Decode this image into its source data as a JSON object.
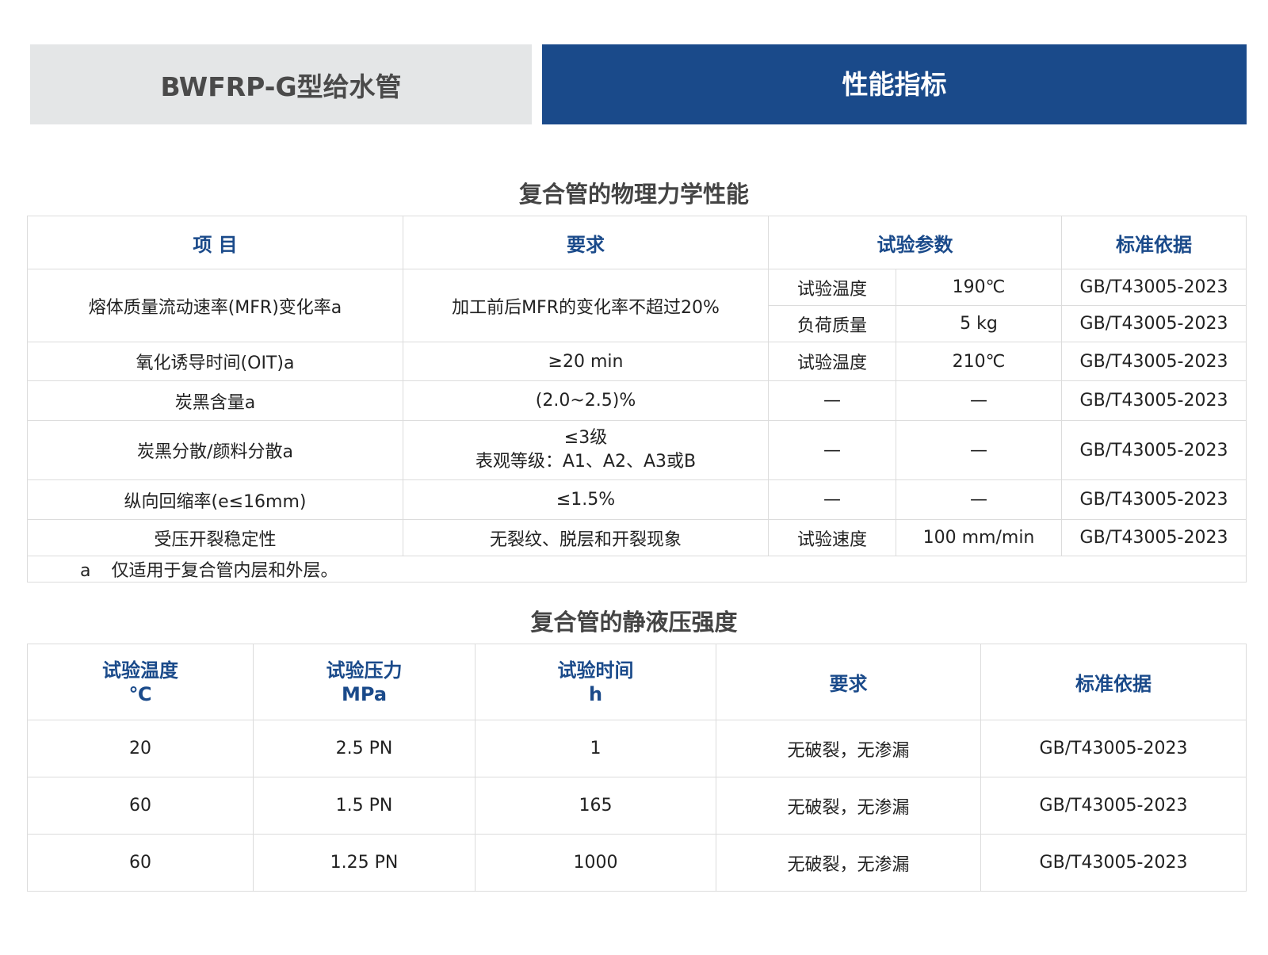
{
  "header": {
    "product": "BWFRP-G型给水管",
    "section": "性能指标"
  },
  "table1": {
    "title": "复合管的物理力学性能",
    "headers": [
      "项 目",
      "要求",
      "试验参数",
      "标准依据"
    ],
    "rows": {
      "mfr": {
        "item": "熔体质量流动速率(MFR)变化率a",
        "req": "加工前后MFR的变化率不超过20%",
        "p1_name": "试验温度",
        "p1_val": "190℃",
        "p1_std": "GB/T43005-2023",
        "p2_name": "负荷质量",
        "p2_val": "5 kg",
        "p2_std": "GB/T43005-2023"
      },
      "oit": {
        "item": "氧化诱导时间(OIT)a",
        "req": "≥20 min",
        "p_name": "试验温度",
        "p_val": "210℃",
        "std": "GB/T43005-2023"
      },
      "cb": {
        "item": "炭黑含量a",
        "req": "(2.0~2.5)%",
        "p_name": "—",
        "p_val": "—",
        "std": "GB/T43005-2023"
      },
      "disp": {
        "item": "炭黑分散/颜料分散a",
        "req_line1": "≤3级",
        "req_line2": "表观等级：A1、A2、A3或B",
        "p_name": "—",
        "p_val": "—",
        "std": "GB/T43005-2023"
      },
      "shrink": {
        "item": "纵向回缩率(e≤16mm)",
        "req": "≤1.5%",
        "p_name": "—",
        "p_val": "—",
        "std": "GB/T43005-2023"
      },
      "crack": {
        "item": "受压开裂稳定性",
        "req": "无裂纹、脱层和开裂现象",
        "p_name": "试验速度",
        "p_val": "100 mm/min",
        "std": "GB/T43005-2023"
      }
    },
    "note": {
      "letter": "a",
      "text": "仅适用于复合管内层和外层。"
    }
  },
  "table2": {
    "title": "复合管的静液压强度",
    "headers": [
      {
        "label": "试验温度",
        "unit": "℃"
      },
      {
        "label": "试验压力",
        "unit": "MPa"
      },
      {
        "label": "试验时间",
        "unit": "h"
      },
      {
        "label": "要求",
        "unit": ""
      },
      {
        "label": "标准依据",
        "unit": ""
      }
    ],
    "rows": [
      {
        "temp": "20",
        "pressure": "2.5 PN",
        "time": "1",
        "req": "无破裂，无渗漏",
        "std": "GB/T43005-2023"
      },
      {
        "temp": "60",
        "pressure": "1.5 PN",
        "time": "165",
        "req": "无破裂，无渗漏",
        "std": "GB/T43005-2023"
      },
      {
        "temp": "60",
        "pressure": "1.25 PN",
        "time": "1000",
        "req": "无破裂，无渗漏",
        "std": "GB/T43005-2023"
      }
    ]
  }
}
